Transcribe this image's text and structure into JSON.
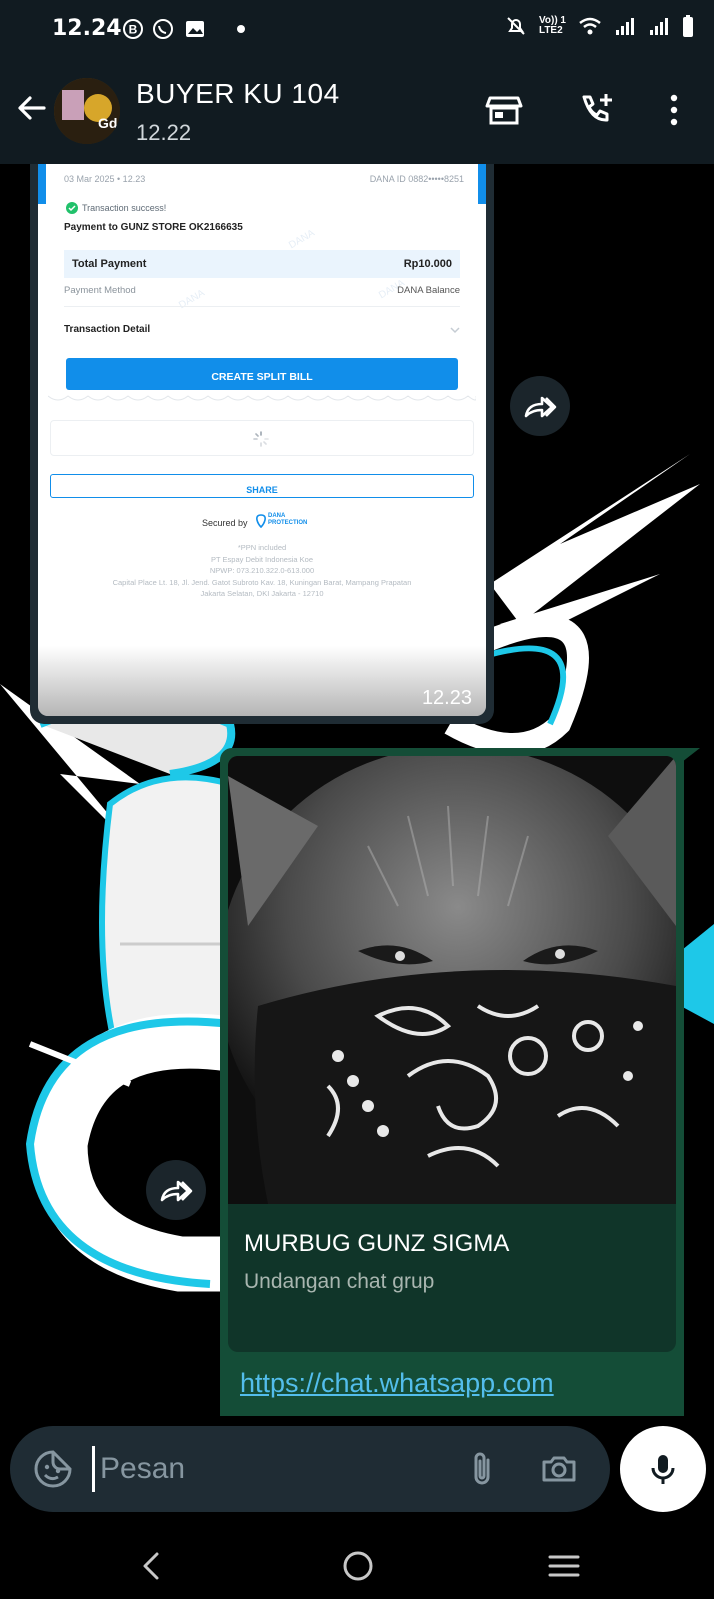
{
  "status_bar": {
    "time": "12.24",
    "network_label_top": "Vo)) 1",
    "network_label_bottom": "LTE2"
  },
  "header": {
    "contact_name": "BUYER KU 104",
    "subtitle": "12.22"
  },
  "receipt": {
    "date": "03 Mar 2025 • 12.23",
    "dana_id": "DANA ID 0882•••••8251",
    "status": "Transaction success!",
    "payment_to": "Payment to GUNZ STORE OK2166635",
    "total_label": "Total Payment",
    "total_value": "Rp10.000",
    "method_label": "Payment Method",
    "method_value": "DANA Balance",
    "detail_label": "Transaction Detail",
    "split_bill_label": "CREATE SPLIT BILL",
    "share_label": "SHARE",
    "secured_by": "Secured by",
    "protection_line1": "DANA",
    "protection_line2": "PROTECTION",
    "footer_line1": "*PPN included",
    "footer_line2": "PT Espay Debit Indonesia Koe",
    "footer_line3": "NPWP: 073.210.322.0-613.000",
    "footer_line4": "Capital Place Lt. 18, Jl. Jend. Gatot Subroto Kav. 18, Kuningan Barat, Mampang Prapatan",
    "footer_line5": "Jakarta Selatan, DKI Jakarta - 12710",
    "watermark": "DANA"
  },
  "image_message": {
    "time": "12.23"
  },
  "invite_message": {
    "group_name": "MURBUG GUNZ SIGMA",
    "subtitle": "Undangan chat grup",
    "link": "https://chat.whatsapp.com"
  },
  "composer": {
    "placeholder": "Pesan"
  },
  "colors": {
    "header_bg": "#111b21",
    "input_bg": "#1f2c34",
    "outgoing_bubble": "#144d37",
    "link": "#53bdeb",
    "dana_blue": "#118eea",
    "accent_cyan": "#1ec8e8"
  },
  "icons": {
    "back": "arrow-left-icon",
    "shop": "storefront-icon",
    "add_call": "phone-plus-icon",
    "menu": "more-vertical-icon",
    "forward": "forward-icon",
    "emoji": "sticker-icon",
    "attach": "paperclip-icon",
    "camera": "camera-icon",
    "mic": "microphone-icon"
  }
}
